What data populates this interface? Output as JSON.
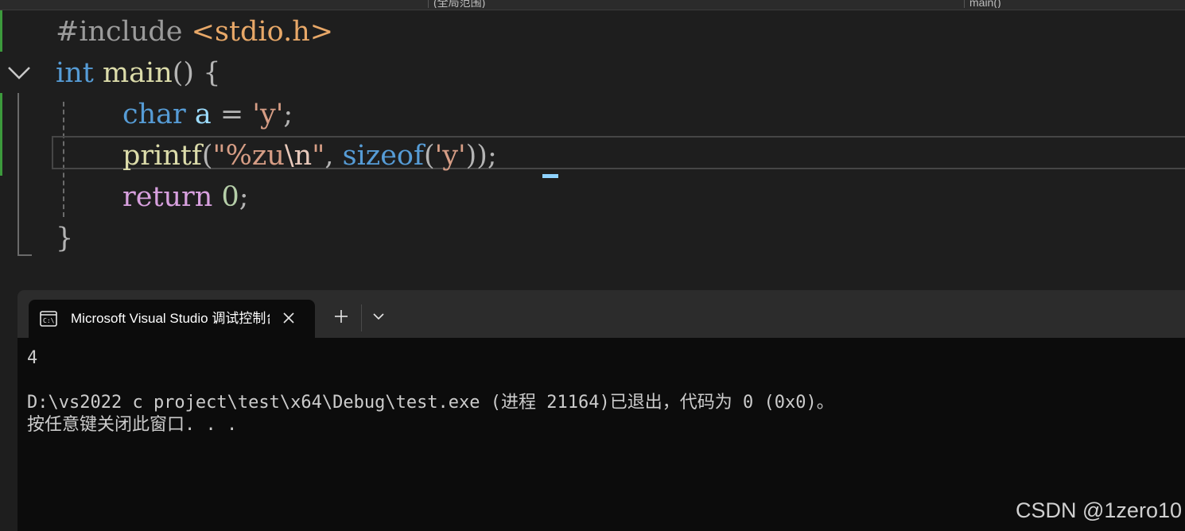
{
  "nav": {
    "scope_label": "(全局范围)",
    "member_label": "main()"
  },
  "code": {
    "line1": {
      "directive": "#include",
      "header": "<stdio.h>"
    },
    "line2": {
      "type": "int",
      "name": "main",
      "paren": "()",
      "brace": "{"
    },
    "line3": {
      "type": "char",
      "var": "a",
      "eq": "=",
      "lit": "'y'",
      "semi": ";"
    },
    "line4": {
      "fn": "printf",
      "open": "(",
      "str_open": "\"%zu",
      "esc": "\\n",
      "str_close": "\"",
      "comma": ",",
      "sizeof": "sizeof",
      "open2": "(",
      "lit": "'y'",
      "close": "))",
      "semi": ";"
    },
    "line5": {
      "kw": "return",
      "num": "0",
      "semi": ";"
    },
    "line6": {
      "brace": "}"
    }
  },
  "terminal": {
    "tab_title": "Microsoft Visual Studio 调试控制台",
    "tab_icon": "terminal-icon",
    "output": [
      "4",
      "",
      "D:\\vs2022 c project\\test\\x64\\Debug\\test.exe (进程 21164)已退出，代码为 0 (0x0)。",
      "按任意键关闭此窗口. . ."
    ]
  },
  "watermark": "CSDN @1zero10",
  "colors": {
    "editor_bg": "#1e1e1e",
    "keyword": "#569cd6",
    "function": "#dcdcaa",
    "string": "#d69d85",
    "control": "#d8a0df",
    "number": "#b5cea8",
    "terminal_bg": "#0c0c0c"
  }
}
